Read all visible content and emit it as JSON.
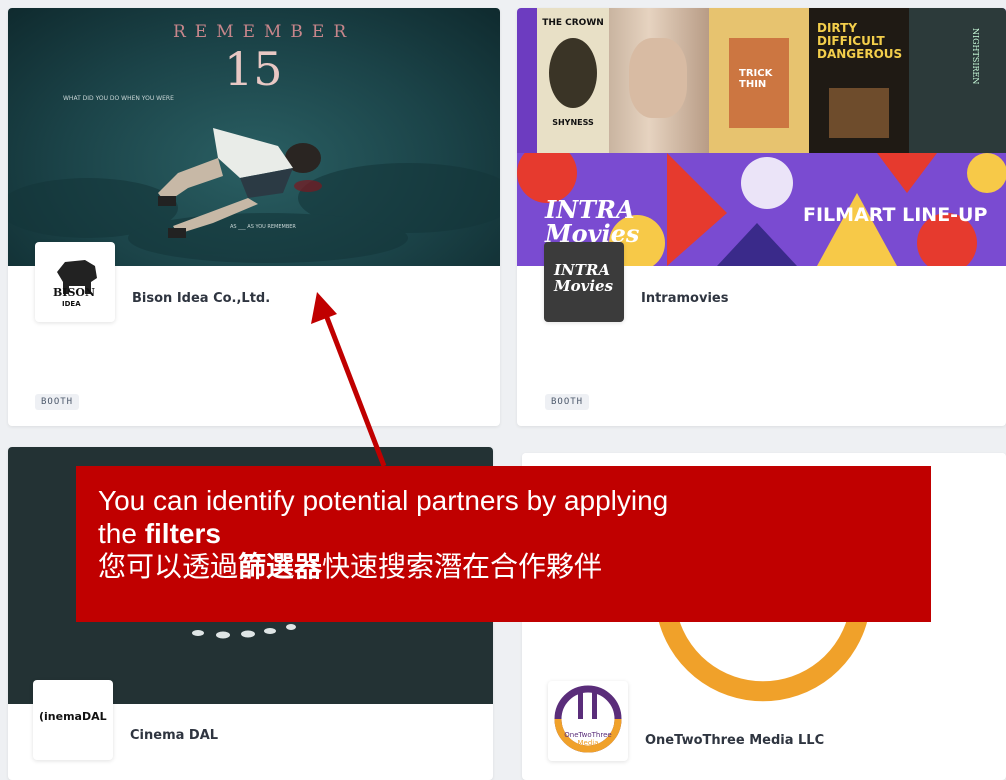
{
  "cards": [
    {
      "company": "Bison Idea Co.,Ltd.",
      "tag": "BOOTH",
      "poster": {
        "title_word": "REMEMBER",
        "title_number": "15",
        "tagline": "WHAT DID YOU DO WHEN YOU WERE",
        "bottom_line": "AS ___ AS YOU REMEMBER"
      },
      "logo_text": [
        "BISON",
        "IDEA"
      ]
    },
    {
      "company": "Intramovies",
      "tag": "BOOTH",
      "posters": [
        "THE CROWN",
        "SHYNESS",
        "TRICK THIN",
        "DIRTY DIFFICULT DANGEROUS",
        "NIGHTSIREN"
      ],
      "banner_brand": [
        "INTRA",
        "Movies"
      ],
      "banner_text": "FILMART LINE-UP",
      "logo_text": [
        "INTRA",
        "Movies"
      ]
    },
    {
      "company": "Cinema DAL",
      "logo_text": "(inemaDAL"
    },
    {
      "company": "OneTwoThree Media LLC",
      "logo_text": [
        "OneTwoThree",
        "Media"
      ]
    }
  ],
  "callout": {
    "line1": "You can identify potential partners by applying",
    "line2_pre": "the ",
    "line2_bold": "filters",
    "line3_pre": "您可以透過",
    "line3_bold": "篩選器",
    "line3_post": "快速搜索潛在合作夥伴"
  },
  "colors": {
    "callout_bg": "#c00000",
    "arrow": "#c00000",
    "teal_cover": "#1d4a4f",
    "dark_cover": "#233234",
    "orange_ring": "#f0a12a"
  }
}
